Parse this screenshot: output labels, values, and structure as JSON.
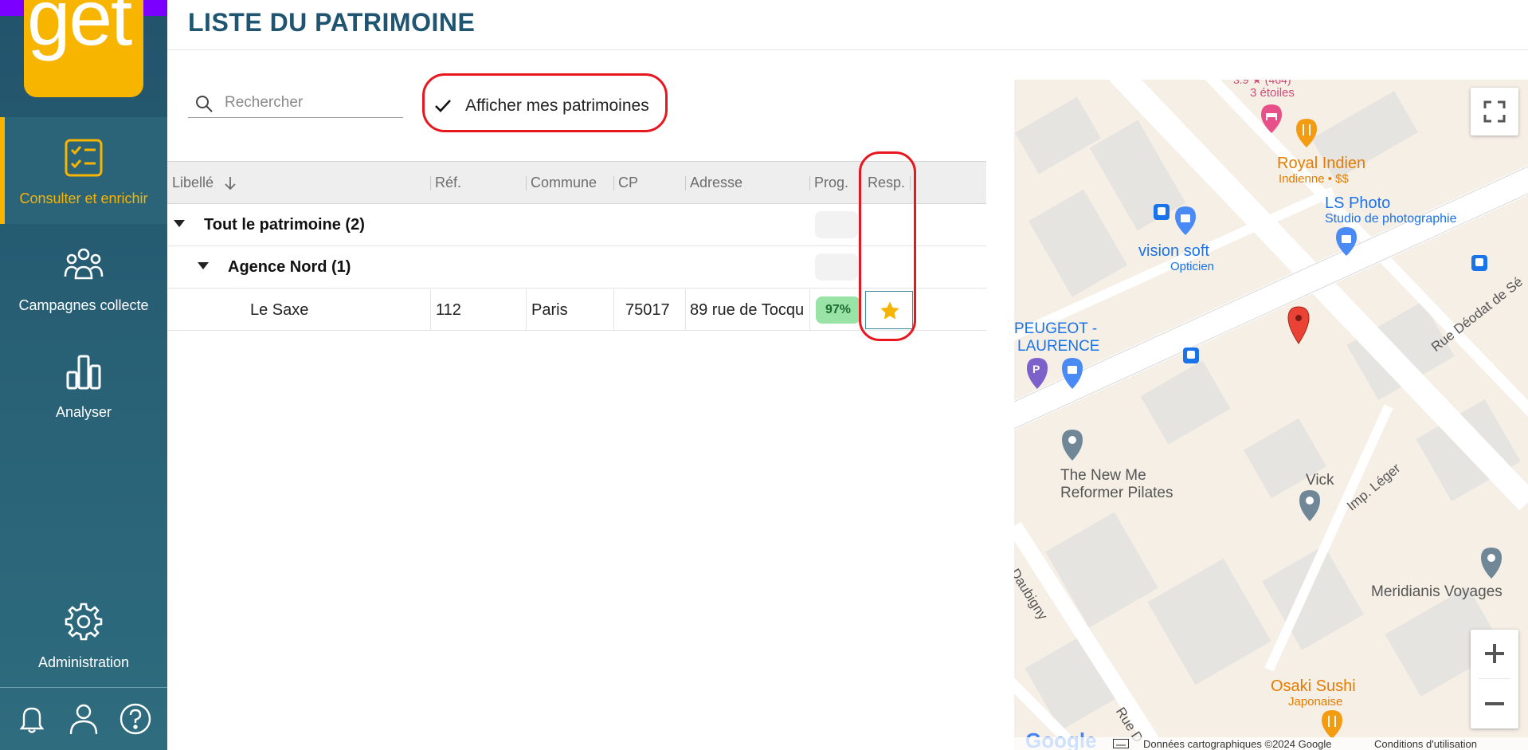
{
  "app": {
    "logo_text": "get"
  },
  "colors": {
    "primary": "#1f5570",
    "accent": "#f7b500",
    "annotation": "#e8161e",
    "progress_good": "#98e3a5"
  },
  "sidebar": {
    "items": [
      {
        "label": "Consulter et enrichir",
        "icon": "checklist-icon",
        "active": true
      },
      {
        "label": "Campagnes collecte",
        "icon": "group-icon",
        "active": false
      },
      {
        "label": "Analyser",
        "icon": "bar-chart-icon",
        "active": false
      },
      {
        "label": "Administration",
        "icon": "gear-icon",
        "active": false
      }
    ],
    "bottom_icons": [
      "bell-icon",
      "user-icon",
      "help-icon"
    ]
  },
  "header": {
    "title": "LISTE DU PATRIMOINE"
  },
  "search": {
    "placeholder": "Rechercher",
    "value": ""
  },
  "filter": {
    "label": "Afficher mes patrimoines",
    "checked": true
  },
  "table": {
    "columns": [
      "Libellé",
      "Réf.",
      "Commune",
      "CP",
      "Adresse",
      "Prog.",
      "Resp."
    ],
    "sort_column": "Libellé",
    "sort_direction": "asc",
    "groups": [
      {
        "label": "Tout le patrimoine (2)",
        "expanded": true
      },
      {
        "label": "Agence Nord (1)",
        "expanded": true
      }
    ],
    "rows": [
      {
        "libelle": "Le Saxe",
        "ref": "112",
        "commune": "Paris",
        "cp": "75017",
        "adresse": "89 rue de Tocqu",
        "progress": "97%",
        "resp_icon": "star-icon"
      }
    ]
  },
  "map": {
    "labels": {
      "hotel_rating": "3.9 ★ (464)",
      "hotel_stars": "3 étoiles",
      "royal_indien": "Royal Indien",
      "royal_indien_sub": "Indienne • $$",
      "ls_photo": "LS Photo",
      "ls_photo_sub": "Studio de photographie",
      "vision_soft": "vision soft",
      "vision_soft_sub": "Opticien",
      "peugeot_1": "PEUGEOT -",
      "peugeot_2": "LAURENCE",
      "rue_deodat": "Rue Déodat de Sé",
      "new_me_1": "The New Me",
      "new_me_2": "Reformer Pilates",
      "vick": "Vick",
      "imp_leger": "Imp. Léger",
      "rue_daubigny": "e Daubigny",
      "meridianis": "Meridianis Voyages",
      "osaki": "Osaki Sushi",
      "osaki_sub": "Japonaise",
      "rue_d": "Rue D",
      "google": "Google",
      "map_data": "Données cartographiques ©2024 Google",
      "terms": "Conditions d'utilisation"
    },
    "controls": [
      "fullscreen-icon",
      "zoom-in-icon",
      "zoom-out-icon"
    ]
  }
}
